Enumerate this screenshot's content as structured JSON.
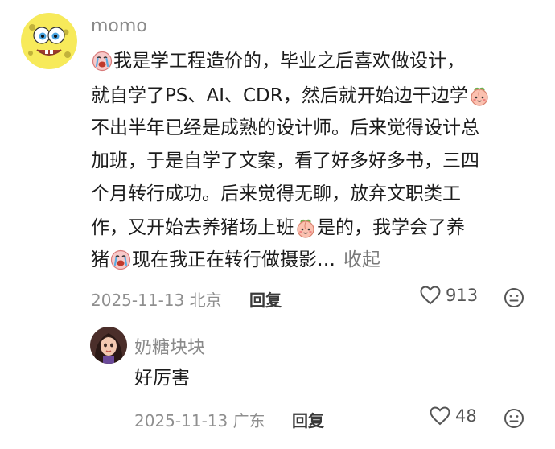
{
  "comment": {
    "username": "momo",
    "body_lines": [
      "我是学工程造价的，毕业之后喜欢做设计，",
      "就自学了PS、AI、CDR，然后就开始边干边学",
      "不出半年已经是成熟的设计师。后来觉得设计总",
      "加班，于是自学了文案，看了好多好多书，三四",
      "个月转行成功。后来觉得无聊，放弃文职类工",
      "作，又开始去养猪场上班",
      "是的，我学会了养",
      "猪",
      "现在我正在转行做摄影…"
    ],
    "collapse_label": "收起",
    "date": "2025-11-13",
    "location": "北京",
    "reply_label": "回复",
    "like_count": "913",
    "icons": {
      "emoji_crying": "crying-face-emoji-icon",
      "emoji_peach": "peach-emoji-icon",
      "like": "heart-outline-icon",
      "more": "neutral-face-icon"
    }
  },
  "reply": {
    "username": "奶糖块块",
    "text": "好厉害",
    "date": "2025-11-13",
    "location": "广东",
    "reply_label": "回复",
    "like_count": "48"
  },
  "colors": {
    "text_primary": "#1c1c1c",
    "text_secondary": "#8f8f8f",
    "link": "#7a7a7a"
  }
}
